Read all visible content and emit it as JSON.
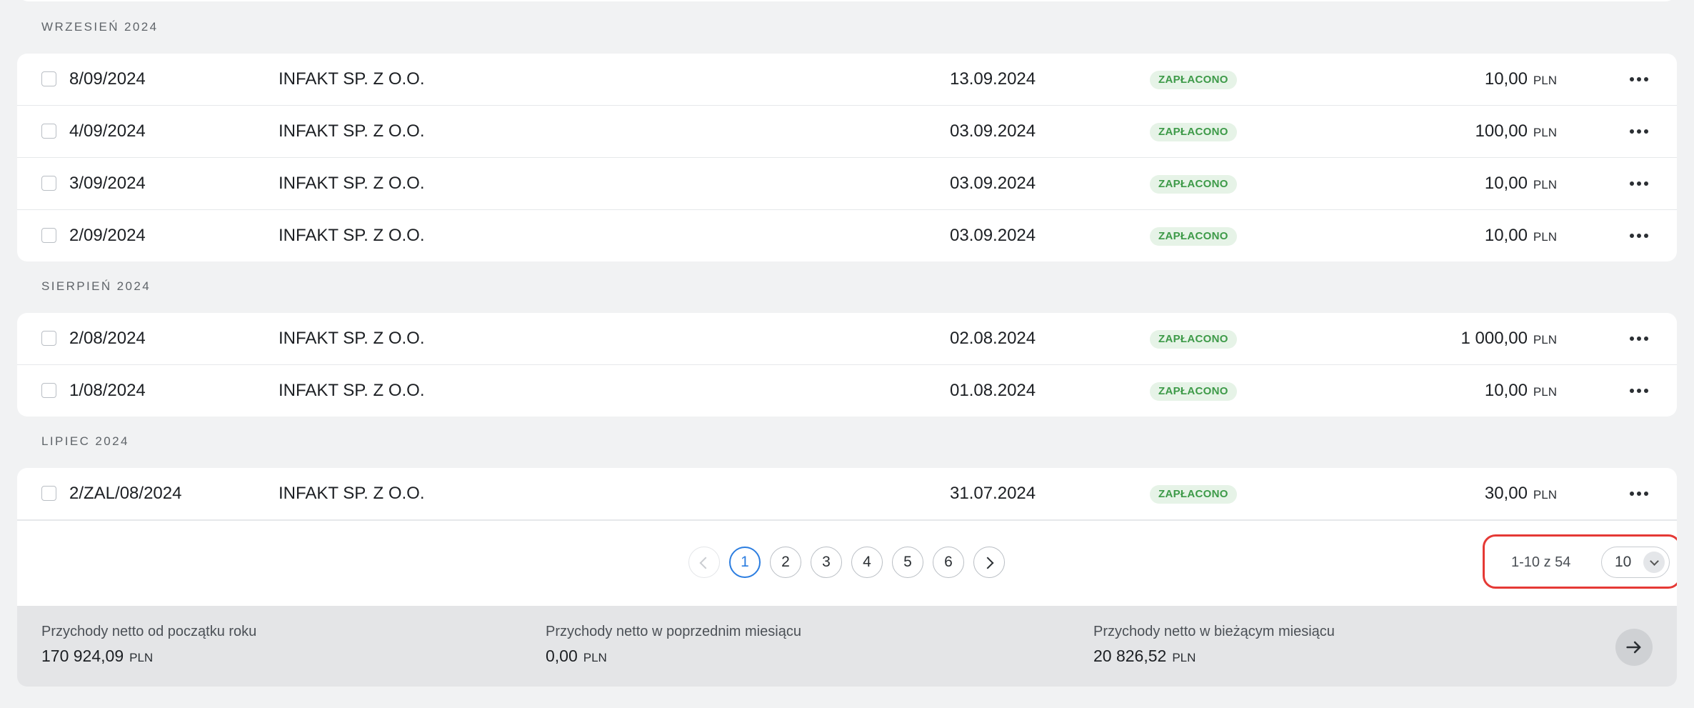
{
  "sections": [
    {
      "title": "WRZESIEŃ 2024",
      "rows": [
        {
          "number": "8/09/2024",
          "client": "INFAKT SP. Z O.O.",
          "date": "13.09.2024",
          "status": "ZAPŁACONO",
          "amount": "10,00",
          "currency": "PLN"
        },
        {
          "number": "4/09/2024",
          "client": "INFAKT SP. Z O.O.",
          "date": "03.09.2024",
          "status": "ZAPŁACONO",
          "amount": "100,00",
          "currency": "PLN"
        },
        {
          "number": "3/09/2024",
          "client": "INFAKT SP. Z O.O.",
          "date": "03.09.2024",
          "status": "ZAPŁACONO",
          "amount": "10,00",
          "currency": "PLN"
        },
        {
          "number": "2/09/2024",
          "client": "INFAKT SP. Z O.O.",
          "date": "03.09.2024",
          "status": "ZAPŁACONO",
          "amount": "10,00",
          "currency": "PLN"
        }
      ]
    },
    {
      "title": "SIERPIEŃ 2024",
      "rows": [
        {
          "number": "2/08/2024",
          "client": "INFAKT SP. Z O.O.",
          "date": "02.08.2024",
          "status": "ZAPŁACONO",
          "amount": "1 000,00",
          "currency": "PLN"
        },
        {
          "number": "1/08/2024",
          "client": "INFAKT SP. Z O.O.",
          "date": "01.08.2024",
          "status": "ZAPŁACONO",
          "amount": "10,00",
          "currency": "PLN"
        }
      ]
    },
    {
      "title": "LIPIEC 2024",
      "rows": [
        {
          "number": "2/ZAL/08/2024",
          "client": "INFAKT SP. Z O.O.",
          "date": "31.07.2024",
          "status": "ZAPŁACONO",
          "amount": "30,00",
          "currency": "PLN"
        }
      ]
    }
  ],
  "pagination": {
    "pages": [
      "1",
      "2",
      "3",
      "4",
      "5",
      "6"
    ],
    "current": "1",
    "range_text": "1-10 z 54",
    "per_page": "10",
    "prev_icon": "chevron-left-icon",
    "next_icon": "chevron-right-icon"
  },
  "summary": {
    "items": [
      {
        "label": "Przychody netto od początku roku",
        "value": "170 924,09",
        "currency": "PLN"
      },
      {
        "label": "Przychody netto w poprzednim miesiącu",
        "value": "0,00",
        "currency": "PLN"
      },
      {
        "label": "Przychody netto w bieżącym miesiącu",
        "value": "20 826,52",
        "currency": "PLN"
      }
    ],
    "arrow_icon": "arrow-right-icon"
  },
  "colors": {
    "background": "#f1f2f3",
    "status_badge_bg": "#e6f3e7",
    "status_badge_text": "#3d9a48",
    "active_page": "#2b7de0",
    "highlight_box": "#e53935"
  }
}
